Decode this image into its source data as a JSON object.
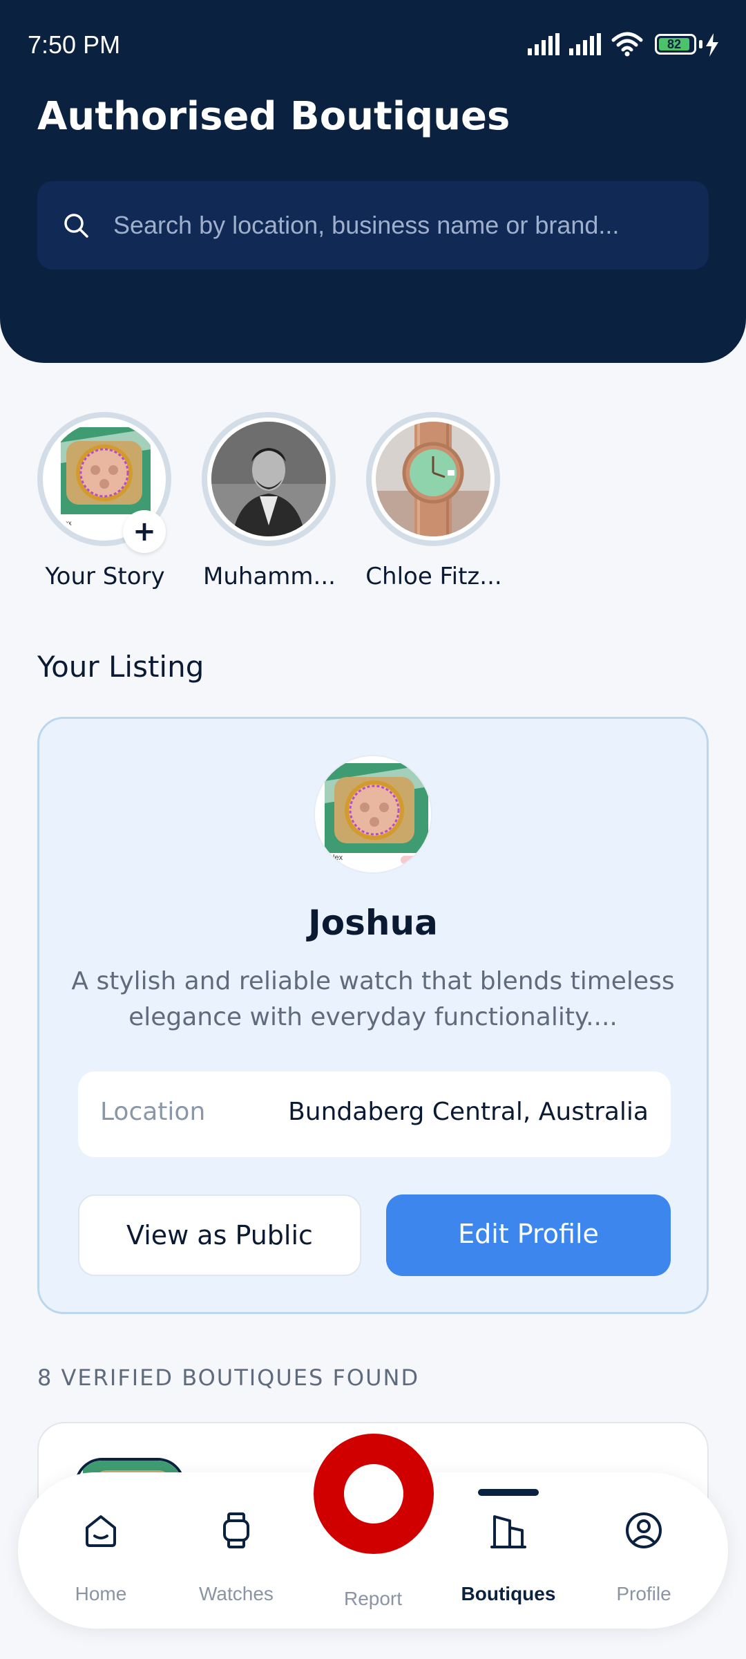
{
  "status_bar": {
    "time": "7:50 PM",
    "battery": "82",
    "icons": [
      "signal-icon",
      "signal-icon",
      "wifi-icon",
      "battery-icon",
      "charging-icon"
    ]
  },
  "header": {
    "title": "Authorised Boutiques",
    "search_placeholder": "Search by location, business name or brand..."
  },
  "stories": [
    {
      "name": "Your Story"
    },
    {
      "name": "Muhamm..."
    },
    {
      "name": "Chloe Fitz..."
    }
  ],
  "listing_section": {
    "title": "Your Listing",
    "name": "Joshua",
    "description": "A stylish and reliable watch that blends timeless elegance with everyday functionality....",
    "location_label": "Location",
    "location_value": "Bundaberg Central, Australia",
    "view_public_label": "View as Public",
    "edit_profile_label": "Edit Profile"
  },
  "boutiques": {
    "count_label": "8 VERIFIED BOUTIQUES FOUND"
  },
  "nav": {
    "items": [
      {
        "label": "Home",
        "icon": "home-icon"
      },
      {
        "label": "Watches",
        "icon": "watch-icon"
      },
      {
        "label": "Report",
        "icon": "report-icon"
      },
      {
        "label": "Boutiques",
        "icon": "building-icon",
        "active": true
      },
      {
        "label": "Profile",
        "icon": "user-icon"
      }
    ]
  },
  "colors": {
    "header_bg": "#0b2140",
    "accent": "#3d86ee",
    "report_red": "#d10000"
  }
}
